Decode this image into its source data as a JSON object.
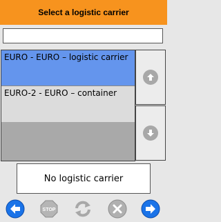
{
  "header": {
    "title": "Select a logistic carrier"
  },
  "search": {
    "value": ""
  },
  "carriers": [
    {
      "label": "EURO - EURO – logistic carrier",
      "selected": true
    },
    {
      "label": "EURO-2 - EURO – container",
      "selected": false
    }
  ],
  "status": {
    "text": "No logistic carrier"
  },
  "toolbar": {
    "stop_label": "STOP"
  },
  "colors": {
    "header": "#f7931e",
    "selected_row": "#6495ed",
    "nav_blue": "#1a73e8",
    "disabled_gray": "#a8a8a8"
  },
  "icons": {
    "scroll_up": "arrow-up-icon",
    "scroll_down": "arrow-down-icon",
    "back": "arrow-left-icon",
    "stop": "stop-icon",
    "refresh": "refresh-icon",
    "cancel": "close-icon",
    "next": "arrow-right-icon"
  }
}
